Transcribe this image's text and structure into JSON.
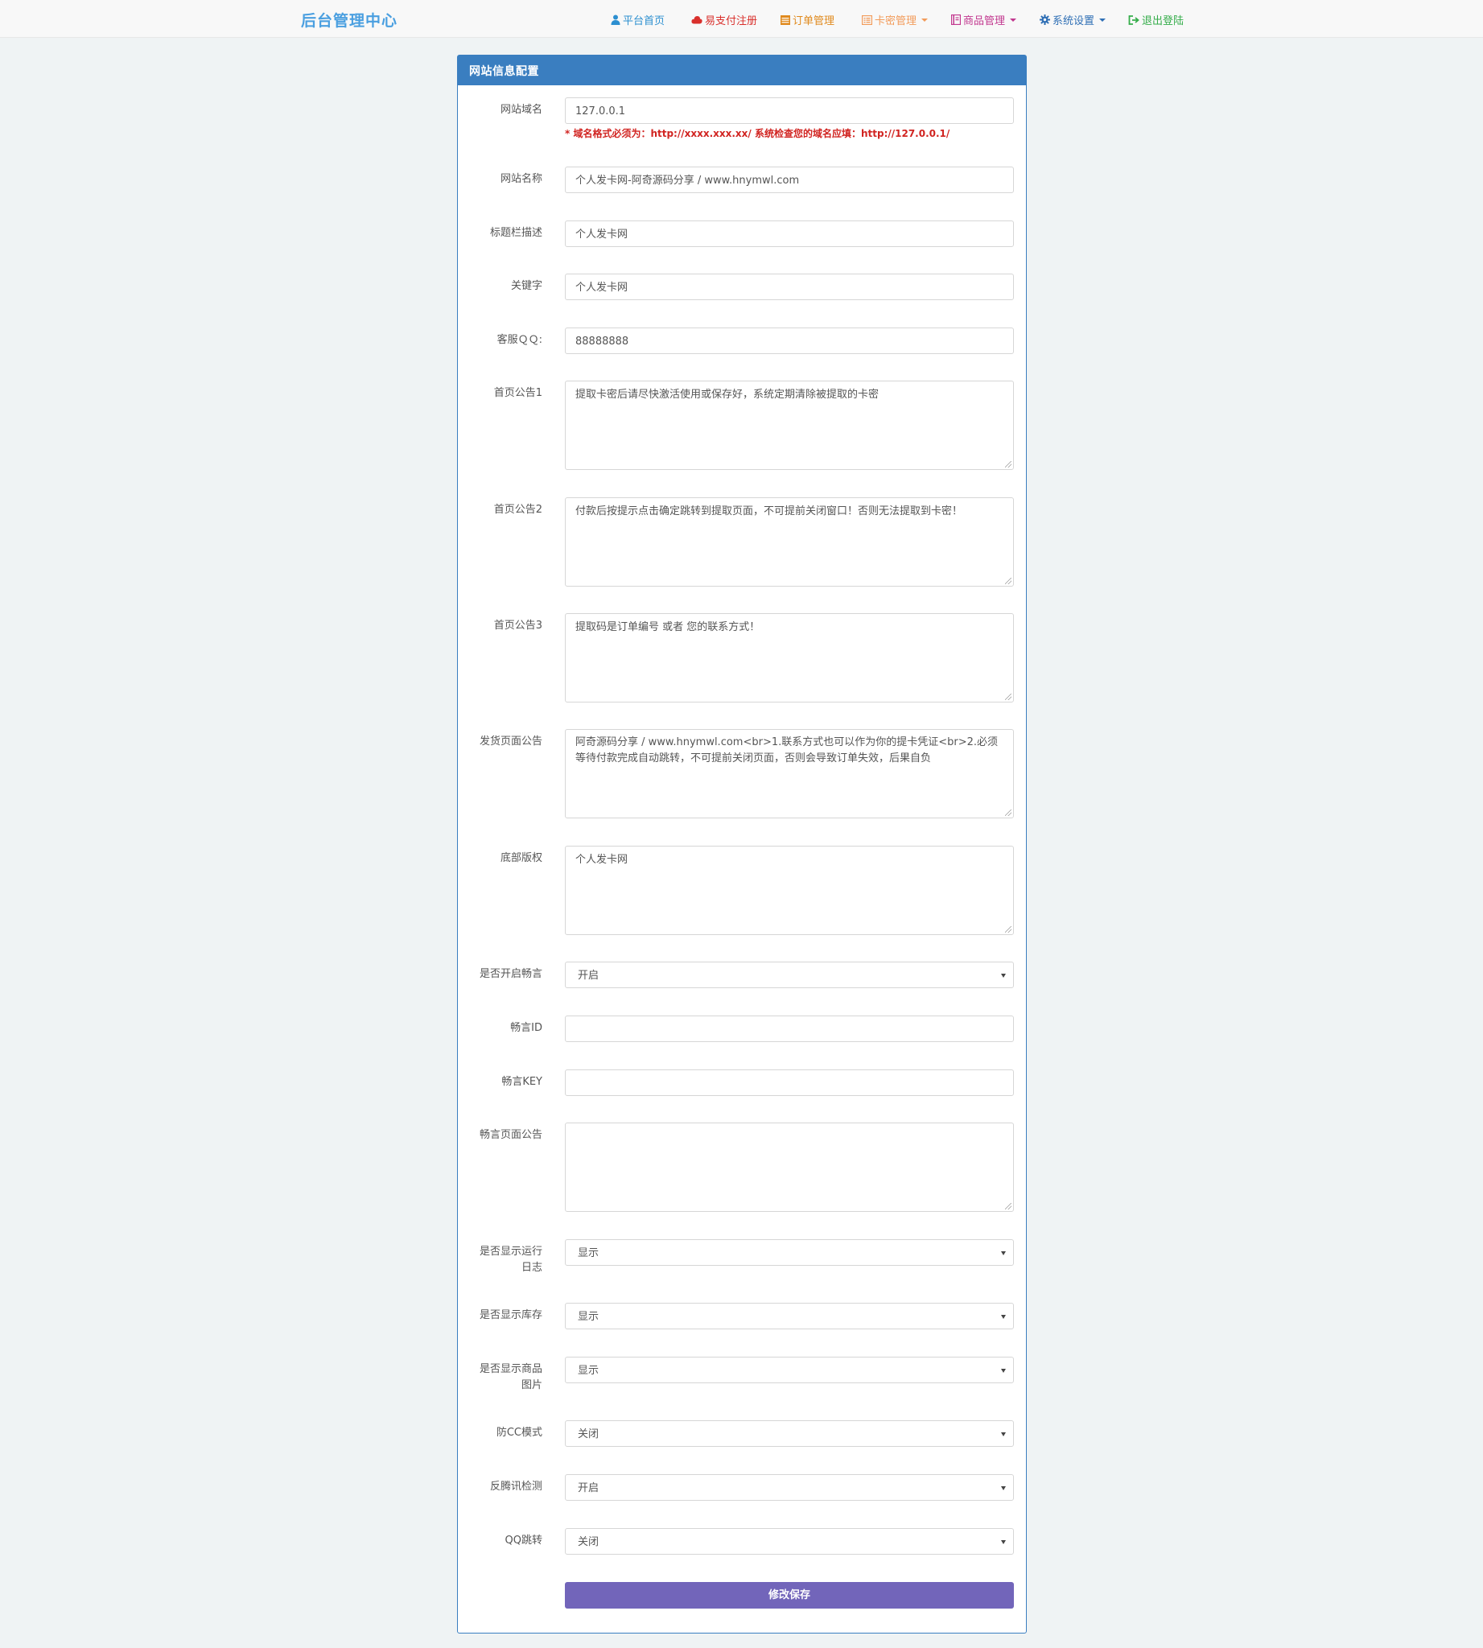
{
  "brand": "后台管理中心",
  "nav": [
    {
      "label": "平台首页",
      "icon": "user-icon",
      "color": "#2c8fd0"
    },
    {
      "label": "易支付注册",
      "icon": "cloud-icon",
      "color": "#d9302c"
    },
    {
      "label": "订单管理",
      "icon": "list-icon",
      "color": "#e08a1e"
    },
    {
      "label": "卡密管理",
      "icon": "list-alt-icon",
      "color": "#f29b5a"
    },
    {
      "label": "商品管理",
      "icon": "book-icon",
      "color": "#c2388f"
    },
    {
      "label": "系统设置",
      "icon": "gear-icon",
      "color": "#2f6fb5"
    },
    {
      "label": "退出登陆",
      "icon": "logout-icon",
      "color": "#35ad4a"
    }
  ],
  "panel": {
    "title": "网站信息配置",
    "domain": {
      "label": "网站域名",
      "value": "127.0.0.1",
      "hint": "* 域名格式必须为：http://xxxx.xxx.xx/ 系统检查您的域名应填：http://127.0.0.1/"
    },
    "site_name": {
      "label": "网站名称",
      "value": "个人发卡网-阿奇源码分享 / www.hnymwl.com"
    },
    "title_desc": {
      "label": "标题栏描述",
      "value": "个人发卡网"
    },
    "keywords": {
      "label": "关键字",
      "value": "个人发卡网"
    },
    "qq": {
      "label": "客服ＱＱ:",
      "value": "88888888"
    },
    "notice1": {
      "label": "首页公告1",
      "value": "提取卡密后请尽快激活使用或保存好，系统定期清除被提取的卡密"
    },
    "notice2": {
      "label": "首页公告2",
      "value": "付款后按提示点击确定跳转到提取页面，不可提前关闭窗口！否则无法提取到卡密！"
    },
    "notice3": {
      "label": "首页公告3",
      "value": "提取码是订单编号 或者 您的联系方式！"
    },
    "delivery_notice": {
      "label": "发货页面公告",
      "value": "阿奇源码分享 / www.hnymwl.com<br>1.联系方式也可以作为你的提卡凭证<br>2.必须等待付款完成自动跳转，不可提前关闭页面，否则会导致订单失效，后果自负"
    },
    "copyright": {
      "label": "底部版权",
      "value": "个人发卡网"
    },
    "changyan_enable": {
      "label": "是否开启畅言",
      "value": "开启"
    },
    "changyan_id": {
      "label": "畅言ID",
      "value": ""
    },
    "changyan_key": {
      "label": "畅言KEY",
      "value": ""
    },
    "changyan_notice": {
      "label": "畅言页面公告",
      "value": ""
    },
    "show_log": {
      "label_line1": "是否显示运行",
      "label_line2": "日志",
      "value": "显示"
    },
    "show_stock": {
      "label": "是否显示库存",
      "value": "显示"
    },
    "show_image": {
      "label_line1": "是否显示商品",
      "label_line2": "图片",
      "value": "显示"
    },
    "anti_cc": {
      "label": "防CC模式",
      "value": "关闭"
    },
    "anti_tencent": {
      "label": "反腾讯检测",
      "value": "开启"
    },
    "qq_redirect": {
      "label": "QQ跳转",
      "value": "关闭"
    },
    "save_label": "修改保存"
  }
}
